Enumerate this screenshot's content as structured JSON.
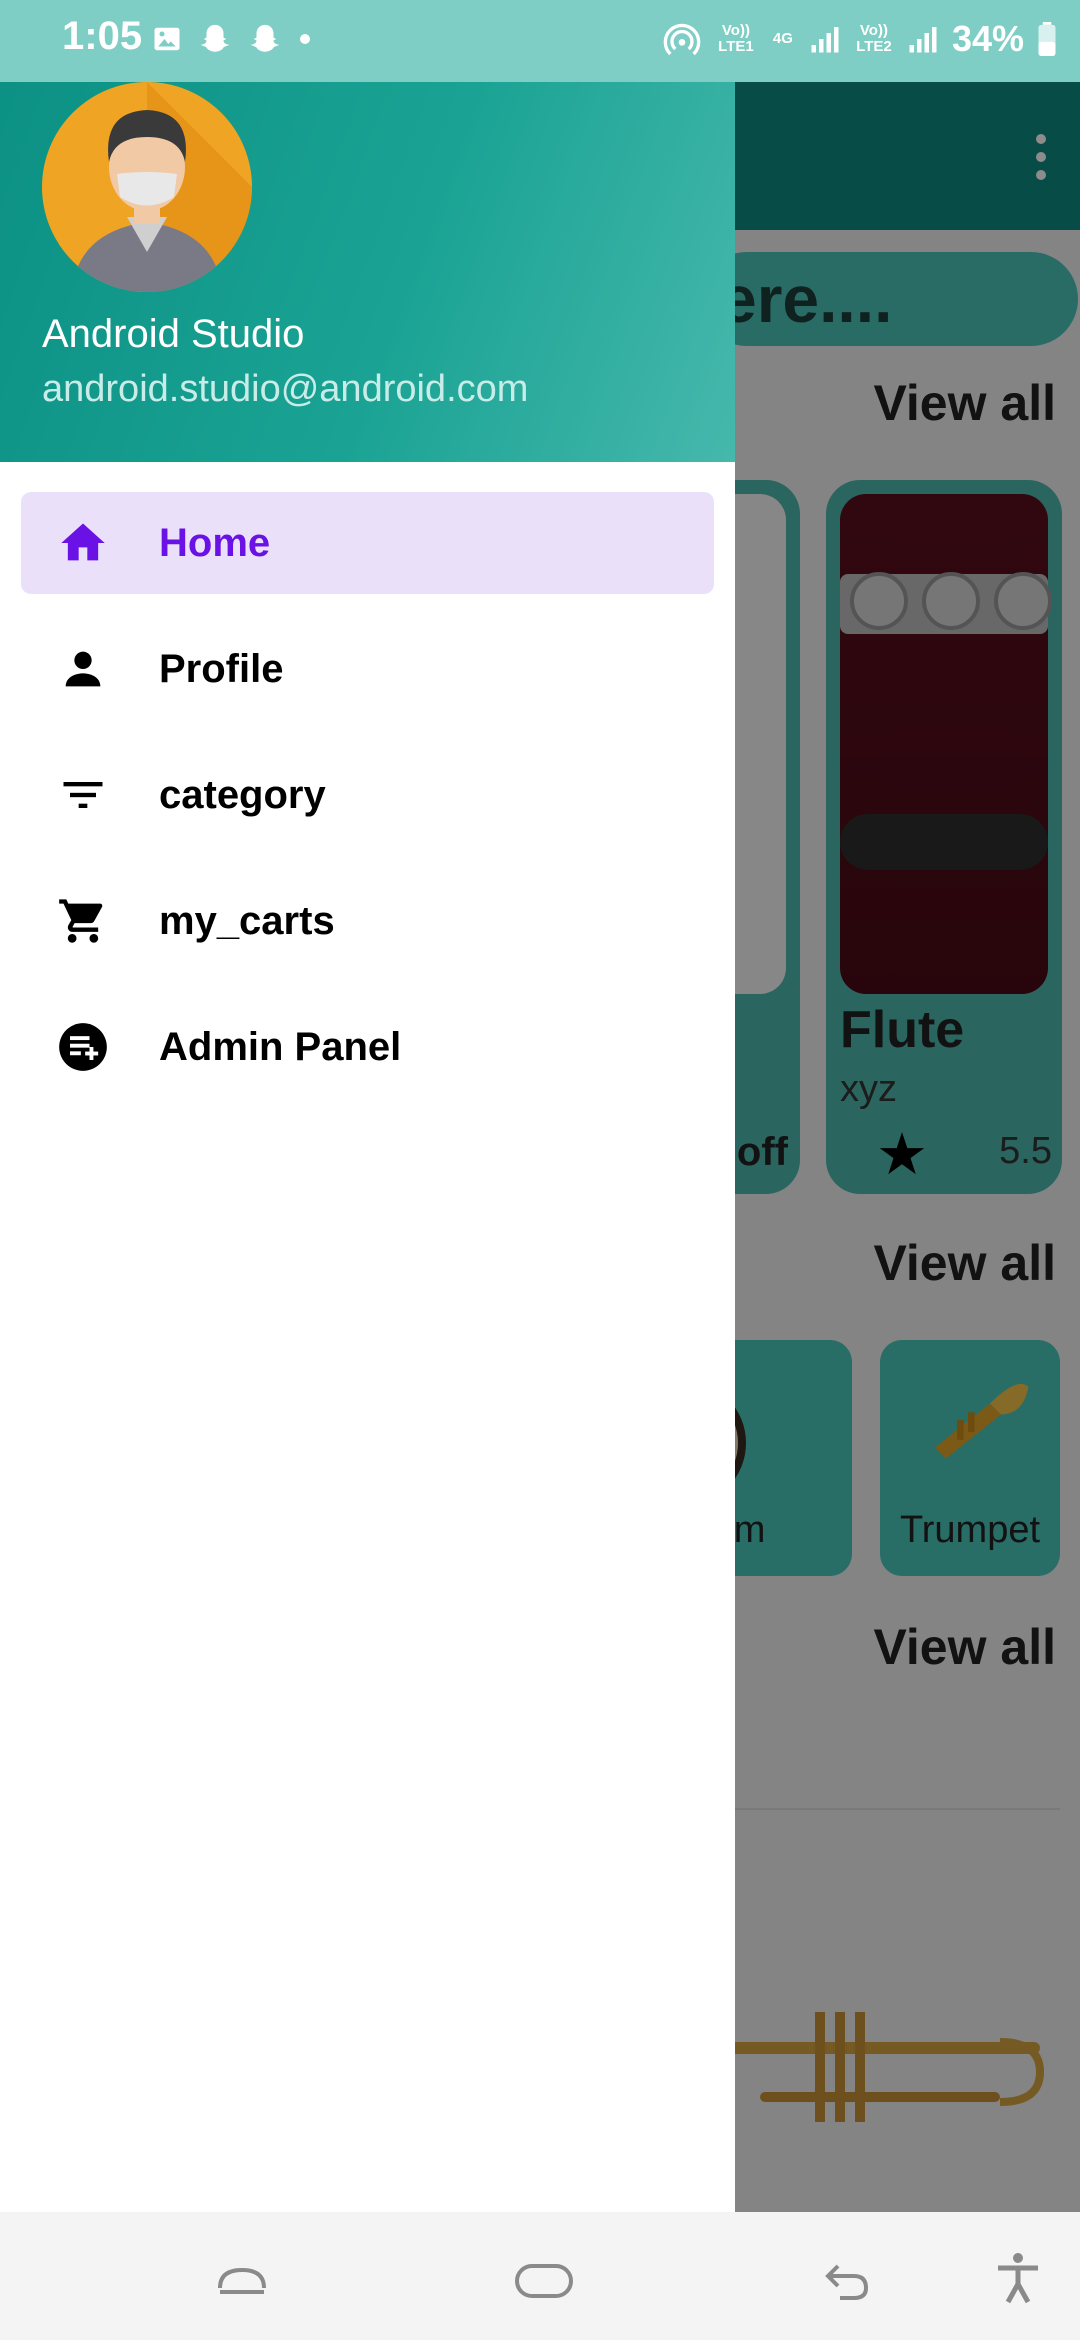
{
  "status_bar": {
    "time": "1:05",
    "battery": "34%",
    "lte1": "Vo)) LTE1",
    "net": "4G",
    "lte2": "Vo)) LTE2"
  },
  "background": {
    "search_text": "ere....",
    "view_all_1": "View all",
    "view_all_2": "View all",
    "view_all_3": "View all",
    "card_off": "off",
    "card_title": "Flute",
    "card_subtitle": "xyz",
    "card_rating": "5.5",
    "category_drum": "rum",
    "category_trumpet": "Trumpet"
  },
  "drawer": {
    "user_name": "Android Studio",
    "user_email": "android.studio@android.com",
    "items": [
      {
        "label": "Home",
        "icon": "home-icon",
        "active": true
      },
      {
        "label": "Profile",
        "icon": "person-icon"
      },
      {
        "label": "category",
        "icon": "filter-icon"
      },
      {
        "label": "my_carts",
        "icon": "cart-icon"
      },
      {
        "label": "Admin Panel",
        "icon": "playlist-add-icon"
      }
    ]
  },
  "colors": {
    "status_bar": "#7ecec5",
    "header": "#0c9184",
    "active_bg": "#ebe0fa",
    "active_text": "#6a11e6"
  }
}
